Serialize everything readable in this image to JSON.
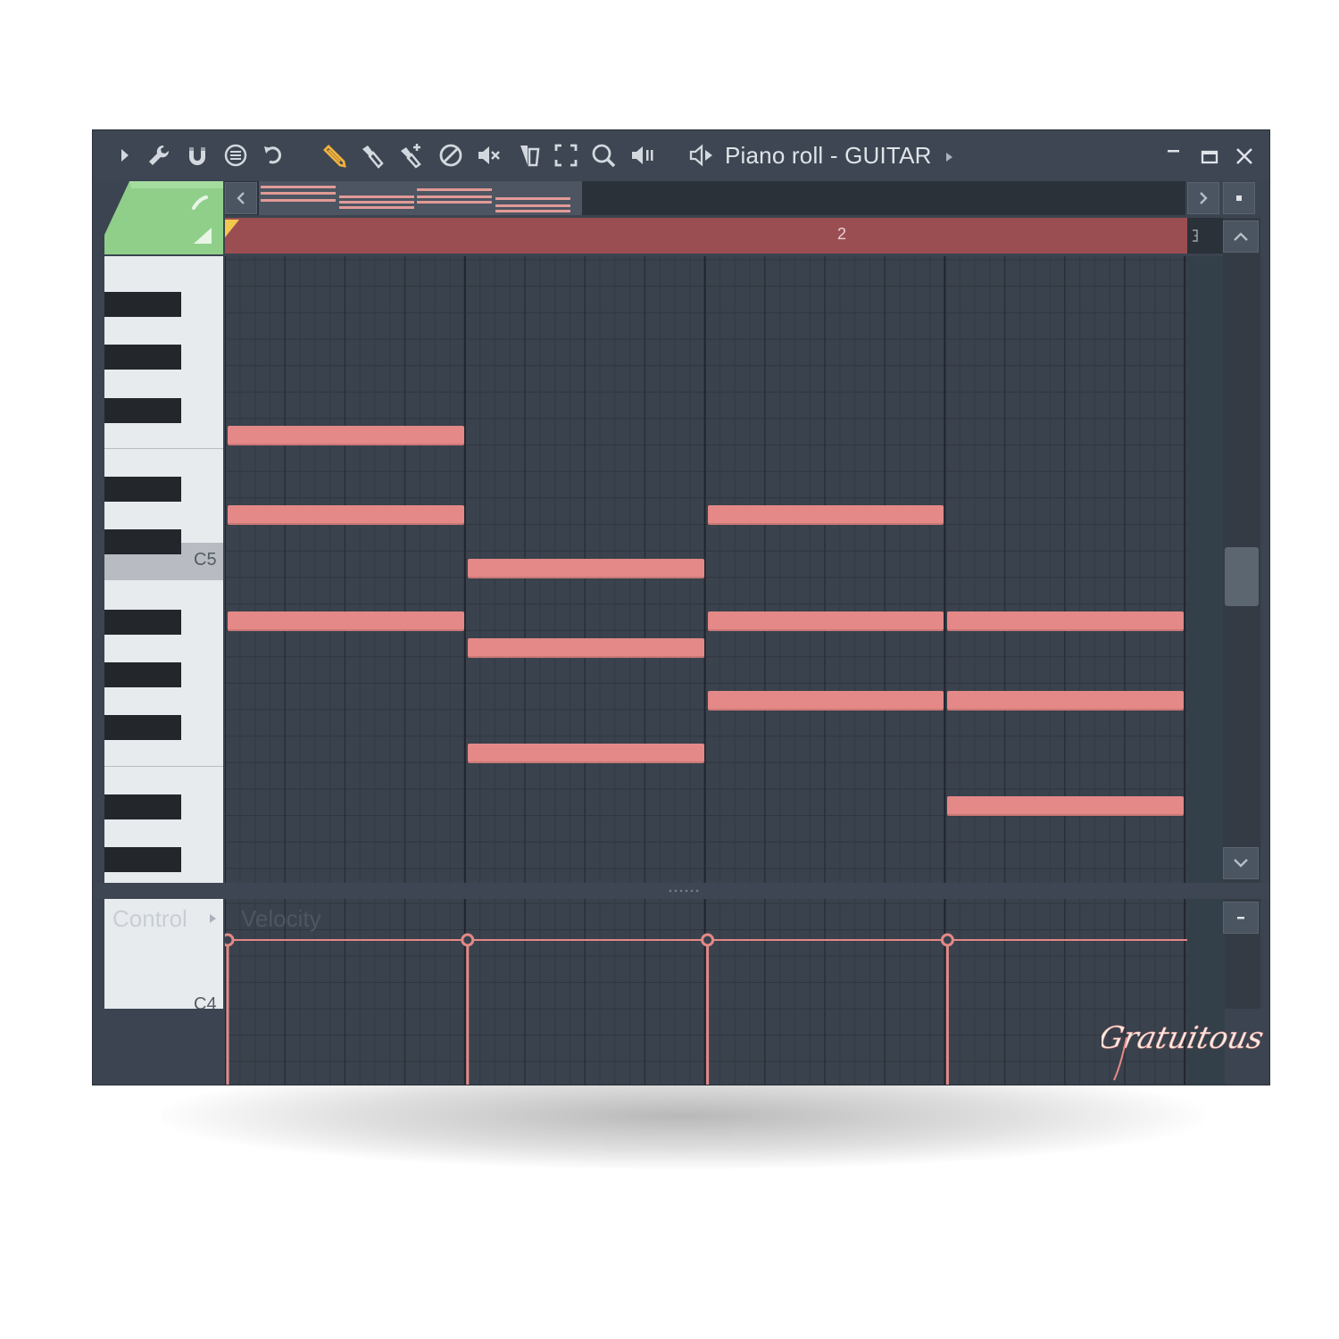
{
  "window": {
    "title": "Piano roll - GUITAR",
    "colors": {
      "background": "#3b4450",
      "note": "#e48987",
      "timeline": "#9b4e52",
      "accent_green": "#8fcf8a"
    }
  },
  "toolbar": {
    "icons": [
      "play-arrow-icon",
      "wrench-icon",
      "magnet-icon",
      "menu-circle-icon",
      "undo-icon",
      "pencil-icon",
      "paint-brush-icon",
      "paint-brush-plus-icon",
      "delete-icon",
      "mute-icon",
      "slice-icon",
      "select-icon",
      "zoom-icon",
      "playback-icon",
      "speaker-icon"
    ]
  },
  "timeline": {
    "bar_label": "2"
  },
  "keyboard": {
    "labels": [
      "C5",
      "C4"
    ]
  },
  "control": {
    "label": "Control",
    "parameter": "Velocity"
  },
  "notes": [
    {
      "start": 0,
      "length": 4,
      "row": 2
    },
    {
      "start": 0,
      "length": 4,
      "row": 5
    },
    {
      "start": 0,
      "length": 4,
      "row": 9
    },
    {
      "start": 4,
      "length": 4,
      "row": 7
    },
    {
      "start": 4,
      "length": 4,
      "row": 10
    },
    {
      "start": 4,
      "length": 4,
      "row": 14
    },
    {
      "start": 8,
      "length": 4,
      "row": 5
    },
    {
      "start": 8,
      "length": 4,
      "row": 9
    },
    {
      "start": 8,
      "length": 4,
      "row": 12
    },
    {
      "start": 12,
      "length": 4,
      "row": 9
    },
    {
      "start": 12,
      "length": 4,
      "row": 12
    },
    {
      "start": 12,
      "length": 4,
      "row": 16
    }
  ],
  "velocity_markers": [
    0,
    4,
    8,
    12
  ],
  "watermark_text": "Gratuitous"
}
